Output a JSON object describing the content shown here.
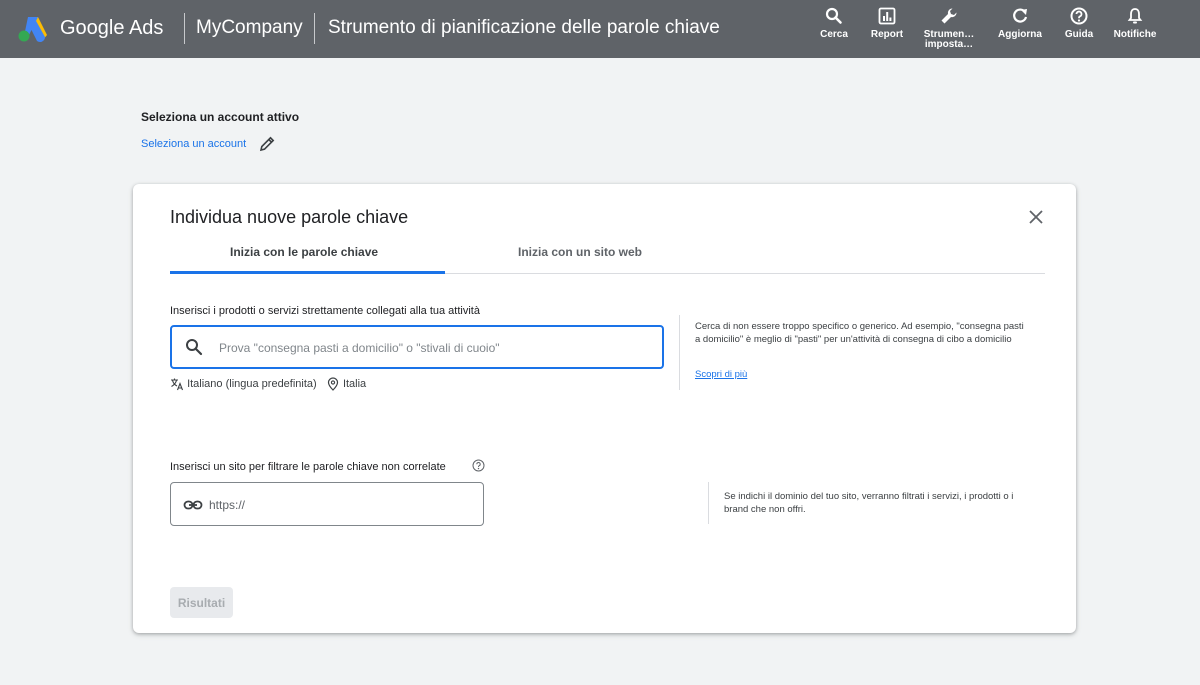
{
  "header": {
    "brand": "Google Ads",
    "account": "MyCompany",
    "page_title": "Strumento di pianificazione delle parole chiave",
    "tools": [
      {
        "label": "Cerca",
        "icon": "search-icon"
      },
      {
        "label": "Report",
        "icon": "report-icon"
      },
      {
        "label": "Strumen…\nimposta…",
        "icon": "wrench-icon"
      },
      {
        "label": "Aggiorna",
        "icon": "refresh-icon"
      },
      {
        "label": "Guida",
        "icon": "help-icon"
      },
      {
        "label": "Notifiche",
        "icon": "bell-icon"
      }
    ]
  },
  "account_select": {
    "title": "Seleziona un account attivo",
    "link": "Seleziona un account"
  },
  "card": {
    "title": "Individua nuove parole chiave",
    "tabs": [
      {
        "label": "Inizia con le parole chiave",
        "active": true
      },
      {
        "label": "Inizia con un sito web",
        "active": false
      }
    ],
    "keywords": {
      "label": "Inserisci i prodotti o servizi strettamente collegati alla tua attività",
      "placeholder": "Prova \"consegna pasti a domicilio\" o \"stivali di cuoio\"",
      "language": "Italiano (lingua predefinita)",
      "location": "Italia",
      "hint": "Cerca di non essere troppo specifico o generico. Ad esempio, \"consegna pasti a domicilio\" è meglio di \"pasti\" per un'attività di consegna di cibo a domicilio",
      "learn_more": "Scopri di più"
    },
    "site": {
      "label": "Inserisci un sito per filtrare le parole chiave non correlate",
      "placeholder": "https://",
      "hint": "Se indichi il dominio del tuo sito, verranno filtrati i servizi, i prodotti o i brand che non offri."
    },
    "results_button": "Risultati"
  },
  "colors": {
    "header_bg": "#5f6368",
    "accent": "#1a73e8",
    "page_bg": "#f1f3f4"
  }
}
